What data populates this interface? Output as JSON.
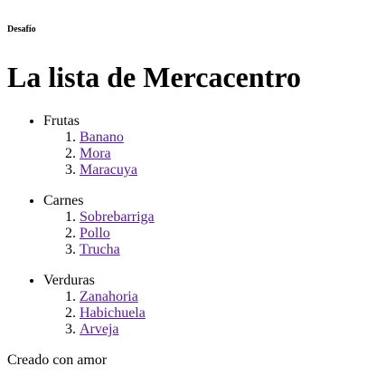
{
  "header": {
    "kicker": "Desafío",
    "title": "La lista de Mercacentro"
  },
  "categories": [
    {
      "name": "Frutas",
      "items": [
        "Banano",
        "Mora",
        "Maracuya"
      ]
    },
    {
      "name": "Carnes",
      "items": [
        "Sobrebarriga",
        "Pollo",
        "Trucha"
      ]
    },
    {
      "name": "Verduras",
      "items": [
        "Zanahoria",
        "Habichuela",
        "Arveja"
      ]
    }
  ],
  "footer": {
    "text": "Creado con amor"
  },
  "colors": {
    "visited_link": "#551a8b",
    "text": "#000000",
    "background": "#ffffff"
  }
}
